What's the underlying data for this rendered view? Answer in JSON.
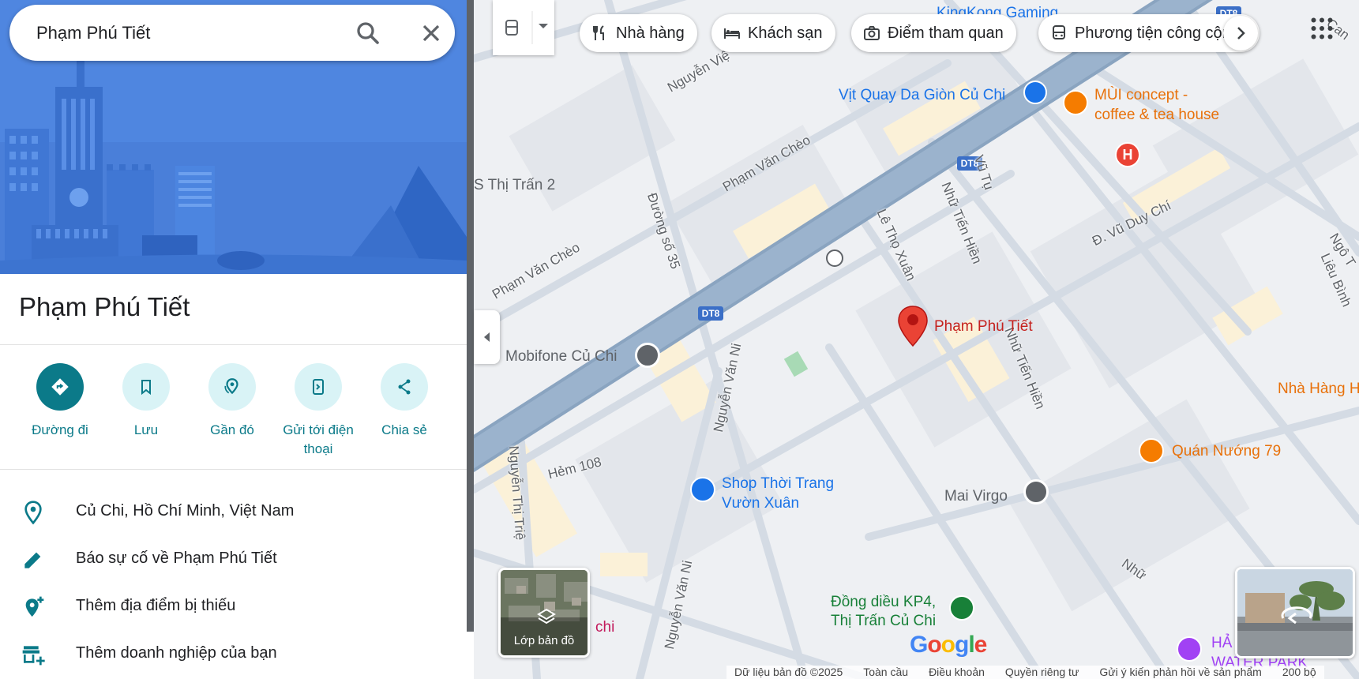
{
  "search": {
    "value": "Phạm Phú Tiết"
  },
  "place": {
    "title": "Phạm Phú Tiết"
  },
  "actions": [
    {
      "label": "Đường đi",
      "icon": "directions-icon"
    },
    {
      "label": "Lưu",
      "icon": "bookmark-icon"
    },
    {
      "label": "Gần đó",
      "icon": "nearby-icon"
    },
    {
      "label": "Gửi tới điện thoại",
      "icon": "send-to-phone-icon"
    },
    {
      "label": "Chia sẻ",
      "icon": "share-icon"
    }
  ],
  "info": [
    {
      "text": "Củ Chi, Hồ Chí Minh, Việt Nam",
      "icon": "location-pin-icon"
    },
    {
      "text": "Báo sự cố về Phạm Phú Tiết",
      "icon": "pencil-icon"
    },
    {
      "text": "Thêm địa điểm bị thiếu",
      "icon": "add-location-icon"
    },
    {
      "text": "Thêm doanh nghiệp của bạn",
      "icon": "add-business-icon"
    }
  ],
  "chips": [
    {
      "label": "Nhà hàng",
      "icon": "restaurant-icon"
    },
    {
      "label": "Khách sạn",
      "icon": "hotel-icon"
    },
    {
      "label": "Điểm tham quan",
      "icon": "camera-icon"
    },
    {
      "label": "Phương tiện công cộng",
      "icon": "bus-icon"
    }
  ],
  "map": {
    "pins": {
      "selected": "Phạm Phú Tiết",
      "vit_quay_line1": "Vịt Quay Da Giòn Củ Chi",
      "mui_line1": "MÙI concept -",
      "mui_line2": "coffee & tea house",
      "kingkong": "KingKong Gaming",
      "mobifone": "Mobifone Củ Chi",
      "shop_line1": "Shop Thời Trang",
      "shop_line2": "Vườn Xuân",
      "mai_virgo": "Mai Virgo",
      "quan_nuong": "Quán Nướng 79",
      "nha_hang": "Nhà Hàng H",
      "dong_dieu_line1": "Đồng diều KP4,",
      "dong_dieu_line2": "Thị Trấn Củ Chi",
      "water_park_line1": "HẢ",
      "water_park_line2": "WATER PARK",
      "chi": "chi",
      "thi_tran": "S Thị Trấn 2"
    },
    "streets": {
      "pham_van_cheo_1": "Phạm Văn Chèo",
      "pham_van_cheo_2": "Phạm Văn Chèo",
      "duong_so_35": "Đường số 35",
      "nguyen_van_ni_1": "Nguyễn Văn Ni",
      "nguyen_van_ni_2": "Nguyễn Văn Ni",
      "le_tho_xuan": "Lê Thọ Xuân",
      "nhu_tien_hien_1": "Nhữ Tiến Hiền",
      "nhu_tien_hien_2": "Nhữ Tiến Hiền",
      "nhu_3": "Nhữ",
      "vu_tu": "Vũ Tụ",
      "vu_duy_chi": "Đ. Vũ Duy Chí",
      "hem_108": "Hẻm 108",
      "nguyen_thi_trie": "Nguyễn Thị Triệ",
      "nguyen_vie": "Nguyễn Việ",
      "ngo_t": "Ngô T",
      "lieu_binh": "Liêu Bình",
      "can": "Can",
      "dt8_1": "DT8",
      "dt8_2": "DT8",
      "dt8_3": "DT8"
    },
    "layers_label": "Lớp bản đồ",
    "google_logo": "Google"
  },
  "footer": {
    "data": "Dữ liệu bản đồ ©2025",
    "global": "Toàn cầu",
    "terms": "Điều khoản",
    "privacy": "Quyền riêng tư",
    "feedback": "Gửi ý kiến phản hồi về sản phẩm",
    "scale": "200 bộ"
  },
  "colors": {
    "accent": "#0b7a89",
    "hero": "#4f86e0",
    "pin_red": "#ea4335",
    "road_main": "#8aa4c0",
    "map_bg": "#eef0f3"
  }
}
